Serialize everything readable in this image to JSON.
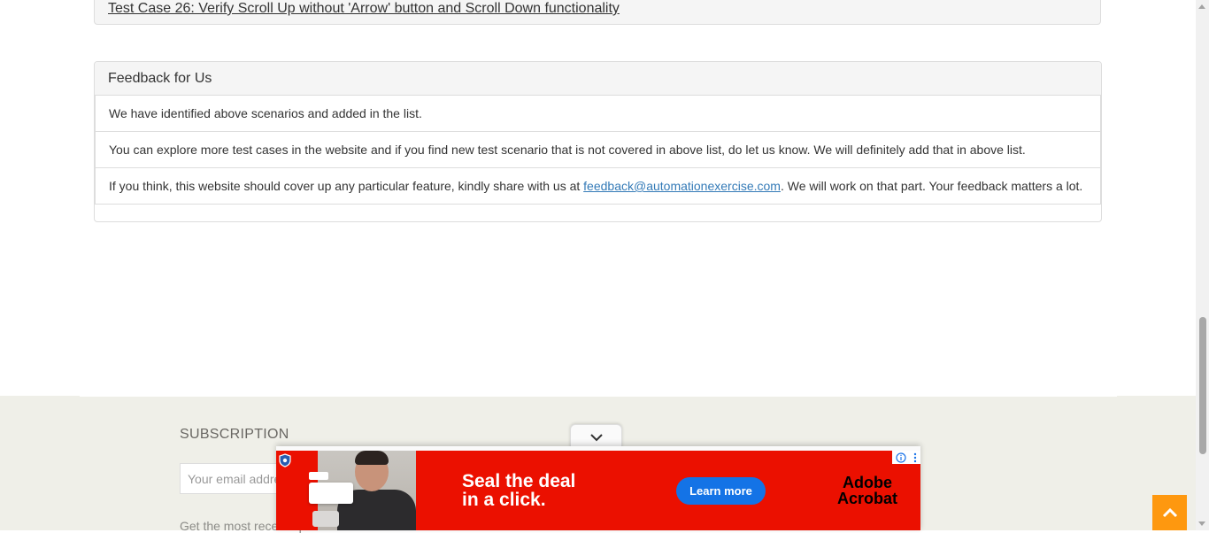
{
  "test_cases": {
    "last_item": "Test Case 26: Verify Scroll Up without 'Arrow' button and Scroll Down functionality"
  },
  "feedback": {
    "title": "Feedback for Us",
    "line1": "We have identified above scenarios and added in the list.",
    "line2": "You can explore more test cases in the website and if you find new test scenario that is not covered in above list, do let us know. We will definitely add that in above list.",
    "line3_before": "If you think, this website should cover up any particular feature, kindly share with us at ",
    "email": "feedback@automationexercise.com",
    "line3_after": ". We will work on that part. Your feedback matters a lot."
  },
  "footer": {
    "subscription_title": "SUBSCRIPTION",
    "email_placeholder": "Your email address",
    "description": "Get the most recent updates from"
  },
  "ad": {
    "headline_1": "Seal the deal",
    "headline_2": "in a click.",
    "cta": "Learn more",
    "brand_1": "Adobe",
    "brand_2": "Acrobat",
    "info_icon": "info-icon",
    "menu_icon": "kebab-menu-icon",
    "colors": {
      "background": "#eb1000",
      "cta": "#1473e6"
    }
  },
  "scroll_up": {
    "icon": "chevron-up-icon",
    "color": "#fe980f"
  }
}
